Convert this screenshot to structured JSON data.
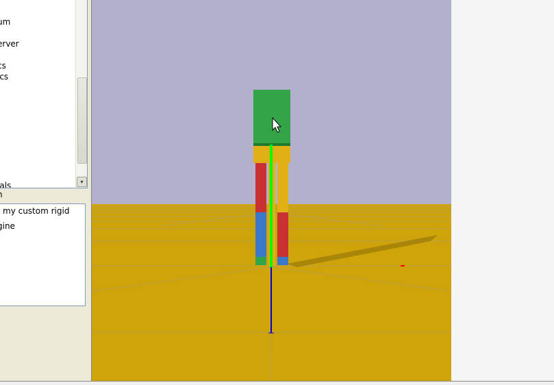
{
  "tree": {
    "items": [
      {
        "label": "um"
      },
      {
        "label": "erver"
      },
      {
        "label": "cs"
      },
      {
        "label": "ics"
      },
      {
        "label": "ials"
      }
    ]
  },
  "section": {
    "label": "n"
  },
  "description": {
    "lines": [
      "my custom rigid",
      "gine"
    ]
  },
  "viewport": {
    "sky_color": "#b1b1cd",
    "ground_color": "#cfa30a",
    "head_color": "#33a548",
    "hip_color": "#e0b016",
    "upper_leg_color": "#c83232",
    "lower_leg_color": "#3c78c8",
    "axis_x_color": "#ff0000",
    "axis_y_color": "#00ff00",
    "axis_z_color": "#0000cc"
  },
  "icons": {
    "scroll_down": "▾",
    "cursor": "arrow-cursor-icon"
  }
}
